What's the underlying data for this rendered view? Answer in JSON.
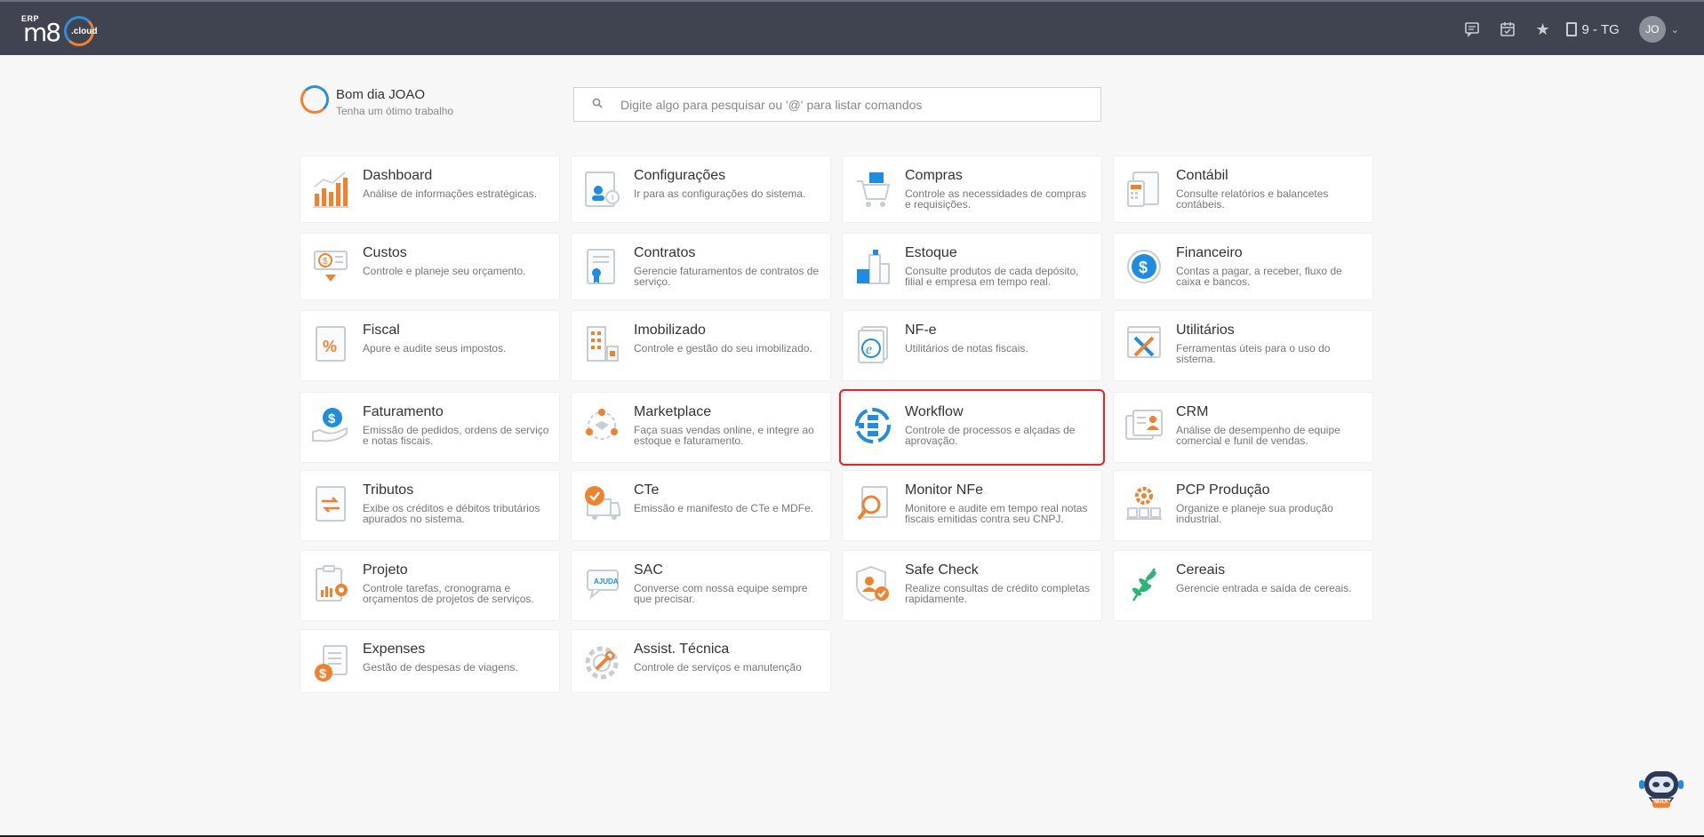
{
  "header": {
    "logo_erp": "ERP",
    "logo_m8": "m8",
    "logo_cloud": ".cloud",
    "icons": [
      "chat-icon",
      "calendar-icon",
      "star-icon"
    ],
    "company": "9 - TG",
    "avatar_initials": "JO"
  },
  "greeting": {
    "title": "Bom dia JOAO",
    "subtitle": "Tenha um ótimo trabalho"
  },
  "search": {
    "placeholder": "Digite algo para pesquisar ou '@' para listar comandos"
  },
  "modules": [
    {
      "title": "Dashboard",
      "desc": "Análise de informações estratégicas.",
      "icon": "chart-icon"
    },
    {
      "title": "Configurações",
      "desc": "Ir para as configurações do sistema.",
      "icon": "settings-icon"
    },
    {
      "title": "Compras",
      "desc": "Controle as necessidades de compras e requisições.",
      "icon": "cart-icon"
    },
    {
      "title": "Contábil",
      "desc": "Consulte relatórios e balancetes contábeis.",
      "icon": "accounting-icon"
    },
    {
      "title": "Custos",
      "desc": "Controle e planeje seu orçamento.",
      "icon": "costs-icon"
    },
    {
      "title": "Contratos",
      "desc": "Gerencie faturamentos de contratos de serviço.",
      "icon": "contract-icon"
    },
    {
      "title": "Estoque",
      "desc": "Consulte produtos de cada depósito, filial e empresa em tempo real.",
      "icon": "stock-icon"
    },
    {
      "title": "Financeiro",
      "desc": "Contas a pagar, a receber, fluxo de caixa e bancos.",
      "icon": "finance-icon"
    },
    {
      "title": "Fiscal",
      "desc": "Apure e audite seus impostos.",
      "icon": "tax-icon"
    },
    {
      "title": "Imobilizado",
      "desc": "Controle e gestão do seu imobilizado.",
      "icon": "building-icon"
    },
    {
      "title": "NF-e",
      "desc": "Utilitários de notas fiscais.",
      "icon": "nfe-icon"
    },
    {
      "title": "Utilitários",
      "desc": "Ferramentas úteis para o uso do sistema.",
      "icon": "tools-icon"
    },
    {
      "title": "Faturamento",
      "desc": "Emissão de pedidos, ordens de serviço e notas fiscais.",
      "icon": "billing-icon"
    },
    {
      "title": "Marketplace",
      "desc": "Faça suas vendas online, e integre ao estoque e faturamento.",
      "icon": "marketplace-icon"
    },
    {
      "title": "Workflow",
      "desc": "Controle de processos e alçadas de aprovação.",
      "icon": "workflow-icon"
    },
    {
      "title": "CRM",
      "desc": "Análise de desempenho de equipe comercial e funil de vendas.",
      "icon": "crm-icon"
    },
    {
      "title": "Tributos",
      "desc": "Exibe os créditos e débitos tributários apurados no sistema.",
      "icon": "tributes-icon"
    },
    {
      "title": "CTe",
      "desc": "Emissão e manifesto de CTe e MDFe.",
      "icon": "truck-icon"
    },
    {
      "title": "Monitor NFe",
      "desc": "Monitore e audite em tempo real notas fiscais emitidas contra seu CNPJ.",
      "icon": "monitor-icon"
    },
    {
      "title": "PCP Produção",
      "desc": "Organize e planeje sua produção industrial.",
      "icon": "production-icon"
    },
    {
      "title": "Projeto",
      "desc": "Controle tarefas, cronograma e orçamentos de projetos de serviços.",
      "icon": "project-icon"
    },
    {
      "title": "SAC",
      "desc": "Converse com nossa equipe sempre que precisar.",
      "icon": "support-icon"
    },
    {
      "title": "Safe Check",
      "desc": "Realize consultas de crédito completas rapidamente.",
      "icon": "shield-icon"
    },
    {
      "title": "Cereais",
      "desc": "Gerencie entrada e saída de cereais.",
      "icon": "plant-icon"
    },
    {
      "title": "Expenses",
      "desc": "Gestão de despesas de viagens.",
      "icon": "expenses-icon"
    },
    {
      "title": "Assist. Técnica",
      "desc": "Controle de serviços e manutenção",
      "icon": "wrench-gear-icon"
    }
  ],
  "selected_module": "Workflow",
  "icon_labels": {
    "sac": "AJUDA",
    "robot": "MAX"
  },
  "colors": {
    "header_bg": "#3f4450",
    "accent_orange": "#f0822e",
    "accent_blue": "#1e8ce0",
    "selection_red": "#e4242a"
  }
}
